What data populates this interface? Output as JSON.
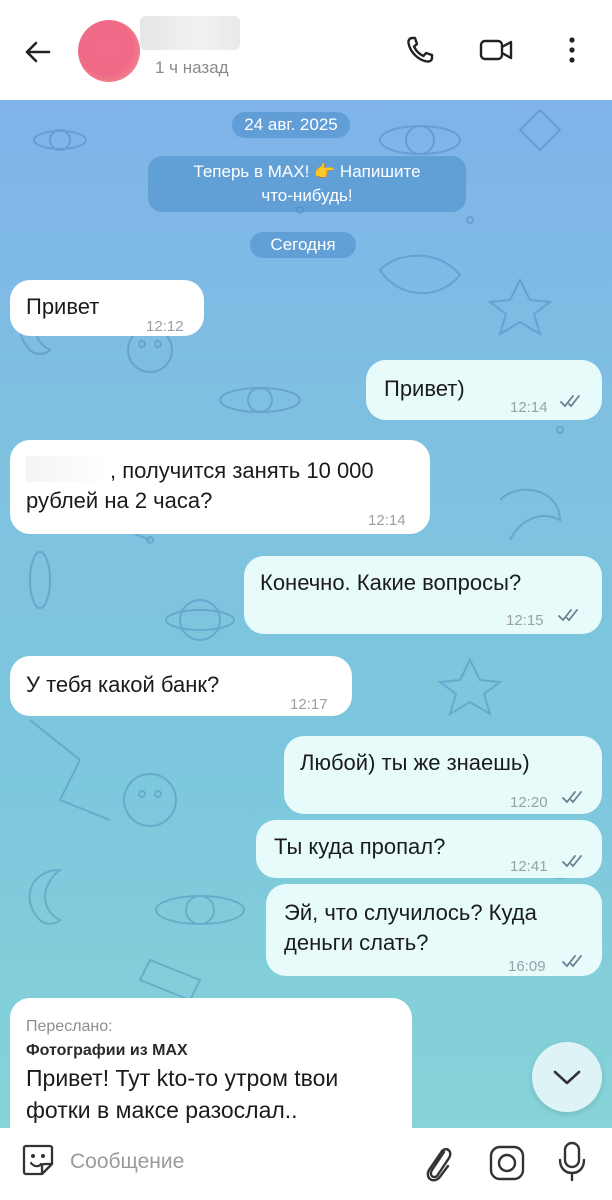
{
  "header": {
    "back_icon": "arrow-left-icon",
    "last_seen": "1 ч назад",
    "icons": [
      "phone-icon",
      "video-camera-icon",
      "more-vertical-icon"
    ]
  },
  "chat": {
    "date_divider": "24 авг. 2025",
    "system_notice": [
      "Теперь в MAX! 👉 Напишите",
      "что-нибудь!"
    ],
    "today_divider": "Сегодня",
    "messages": [
      {
        "direction": "in",
        "lines": [
          "Привет"
        ],
        "time": "12:12"
      },
      {
        "direction": "out",
        "lines": [
          "Привет)"
        ],
        "time": "12:14",
        "read": true
      },
      {
        "direction": "in",
        "lines": [
          ", получится занять 10 000",
          "рублей на 2 часа?"
        ],
        "time": "12:14"
      },
      {
        "direction": "out",
        "lines": [
          "Конечно. Какие вопросы?"
        ],
        "time": "12:15",
        "read": true
      },
      {
        "direction": "in",
        "lines": [
          "У тебя какой банк?"
        ],
        "time": "12:17"
      },
      {
        "direction": "out",
        "lines": [
          "Любой) ты же знаешь)"
        ],
        "time": "12:20",
        "read": true
      },
      {
        "direction": "out",
        "lines": [
          "Ты куда пропал?"
        ],
        "time": "12:41",
        "read": true
      },
      {
        "direction": "out",
        "lines": [
          "Эй, что случилось? Куда",
          "деньги слать?"
        ],
        "time": "16:09",
        "read": true
      },
      {
        "direction": "in",
        "forwarded_label": "Переслано:",
        "forwarded_from": "Фотографии из MAX",
        "lines": [
          "Привет! Тут kto-то утром tвои",
          "фотки в максе разослал.."
        ]
      }
    ]
  },
  "composer": {
    "placeholder": "Сообщение",
    "icons": [
      "sticker-icon",
      "paperclip-icon",
      "camera-icon",
      "microphone-icon"
    ]
  },
  "colors": {
    "bubble_in": "#ffffff",
    "bubble_out": "#e8fbfb",
    "chat_bg_top": "#7fb3ea",
    "chat_bg_bottom": "#86d3d8",
    "tick_color": "#6b7f91"
  }
}
